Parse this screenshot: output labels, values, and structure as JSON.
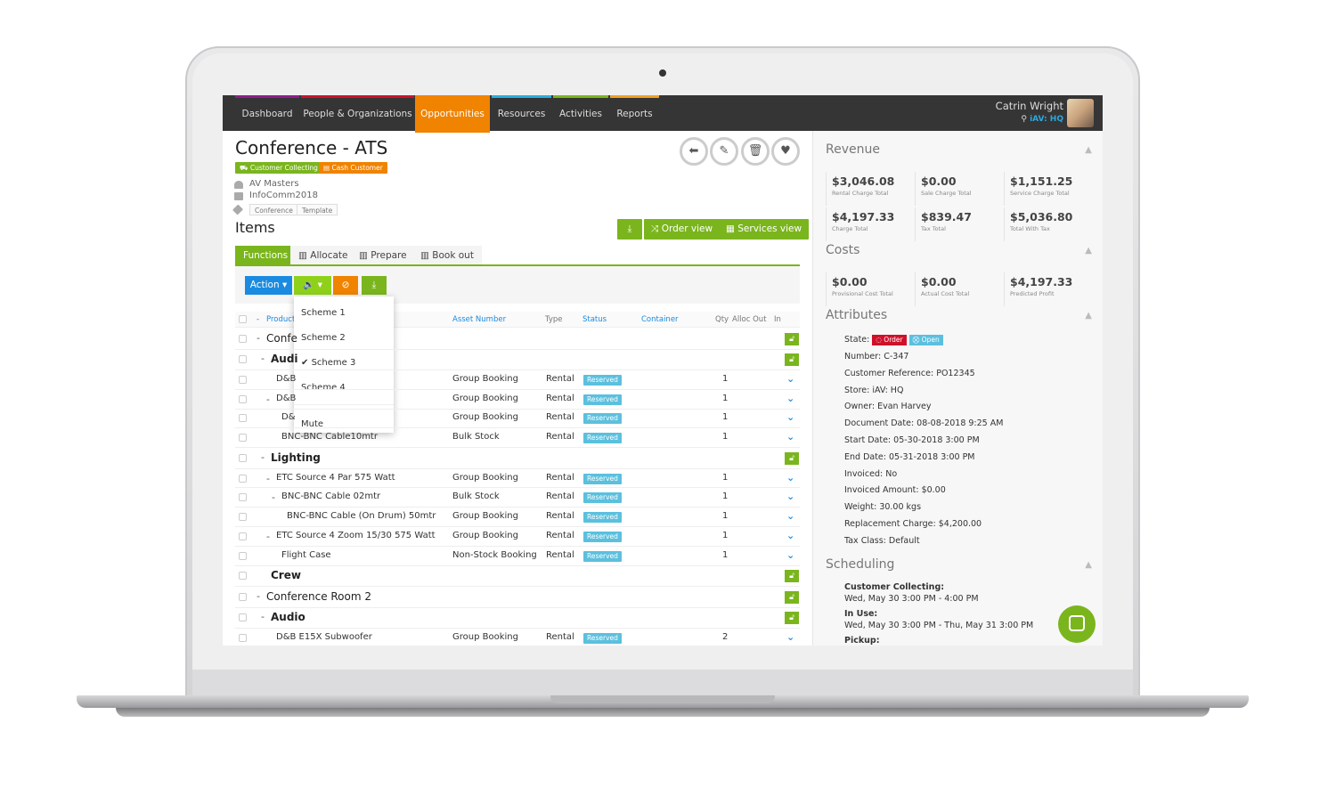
{
  "nav": {
    "items": [
      "Dashboard",
      "People & Organizations",
      "Opportunities",
      "Resources",
      "Activities",
      "Reports"
    ],
    "active": "Opportunities",
    "stripe_colors": [
      "#8e1f8e",
      "#d0102a",
      "#f08300",
      "#29aee0",
      "#7ab51d",
      "#f0a020"
    ]
  },
  "user": {
    "name": "Catrin Wright",
    "location": "iAV: HQ"
  },
  "header": {
    "title": "Conference - ATS",
    "tags": [
      "Customer Collecting",
      "Cash Customer"
    ],
    "organization": "AV Masters",
    "project": "InfoComm2018",
    "labels": [
      "Conference",
      "Template"
    ]
  },
  "actions": {
    "icons": [
      "back-arrow-icon",
      "pencil-icon",
      "trash-icon",
      "heart-icon"
    ]
  },
  "items": {
    "title": "Items",
    "order_view": "Order view",
    "services_view": "Services view",
    "tabs": [
      "Functions",
      "Allocate",
      "Prepare",
      "Book out"
    ],
    "action": "Action ▾"
  },
  "dropdown": {
    "options": [
      "Scheme 1",
      "Scheme 2",
      "Scheme 3",
      "Scheme 4"
    ],
    "selected": "Scheme 3",
    "mute": "Mute"
  },
  "table": {
    "headers": {
      "product": "Product",
      "asset": "Asset Number",
      "type": "Type",
      "status": "Status",
      "container": "Container",
      "qty": "Qty",
      "alloc": "Alloc Out",
      "in": "In"
    },
    "rows": [
      {
        "kind": "group",
        "level": 0,
        "name": "Confe"
      },
      {
        "kind": "group",
        "level": 1,
        "name": "Audi"
      },
      {
        "kind": "item",
        "level": 1,
        "dash": false,
        "name": "D&B",
        "asset": "Group Booking",
        "type": "Rental",
        "status": "Reserved",
        "qty": "1"
      },
      {
        "kind": "item",
        "level": 1,
        "dash": true,
        "name": "D&B",
        "asset": "Group Booking",
        "type": "Rental",
        "status": "Reserved",
        "qty": "1"
      },
      {
        "kind": "item",
        "level": 2,
        "dash": false,
        "name": "D&",
        "asset": "Group Booking",
        "type": "Rental",
        "status": "Reserved",
        "qty": "1"
      },
      {
        "kind": "item",
        "level": 2,
        "dash": false,
        "name": "BNC-BNC Cable10mtr",
        "asset": "Bulk Stock",
        "type": "Rental",
        "status": "Reserved",
        "qty": "1"
      },
      {
        "kind": "group",
        "level": 1,
        "name": "Lighting"
      },
      {
        "kind": "item",
        "level": 1,
        "dash": true,
        "name": "ETC Source 4 Par 575 Watt",
        "asset": "Group Booking",
        "type": "Rental",
        "status": "Reserved",
        "qty": "1"
      },
      {
        "kind": "item",
        "level": 2,
        "dash": true,
        "name": "BNC-BNC Cable 02mtr",
        "asset": "Bulk Stock",
        "type": "Rental",
        "status": "Reserved",
        "qty": "1"
      },
      {
        "kind": "item",
        "level": 3,
        "dash": false,
        "name": "BNC-BNC Cable (On Drum) 50mtr",
        "asset": "Group Booking",
        "type": "Rental",
        "status": "Reserved",
        "qty": "1"
      },
      {
        "kind": "item",
        "level": 1,
        "dash": true,
        "name": "ETC Source 4 Zoom 15/30 575 Watt",
        "asset": "Group Booking",
        "type": "Rental",
        "status": "Reserved",
        "qty": "1"
      },
      {
        "kind": "item",
        "level": 2,
        "dash": false,
        "name": "Flight Case",
        "asset": "Non-Stock Booking",
        "type": "Rental",
        "status": "Reserved",
        "qty": "1"
      },
      {
        "kind": "group",
        "level": 1,
        "nodash": true,
        "name": "Crew"
      },
      {
        "kind": "group",
        "level": 0,
        "name": "Conference Room 2"
      },
      {
        "kind": "group",
        "level": 1,
        "name": "Audio"
      },
      {
        "kind": "item",
        "level": 1,
        "dash": false,
        "name": "D&B E15X Subwoofer",
        "asset": "Group Booking",
        "type": "Rental",
        "status": "Reserved",
        "qty": "2"
      }
    ]
  },
  "revenue": {
    "title": "Revenue",
    "stats": [
      {
        "value": "$3,046.08",
        "label": "Rental Charge Total"
      },
      {
        "value": "$0.00",
        "label": "Sale Charge Total"
      },
      {
        "value": "$1,151.25",
        "label": "Service Charge Total"
      },
      {
        "value": "$4,197.33",
        "label": "Charge Total"
      },
      {
        "value": "$839.47",
        "label": "Tax Total"
      },
      {
        "value": "$5,036.80",
        "label": "Total With Tax"
      }
    ]
  },
  "costs": {
    "title": "Costs",
    "stats": [
      {
        "value": "$0.00",
        "label": "Provisional Cost Total"
      },
      {
        "value": "$0.00",
        "label": "Actual Cost Total"
      },
      {
        "value": "$4,197.33",
        "label": "Predicted Profit"
      }
    ]
  },
  "attributes": {
    "title": "Attributes",
    "state_label": "State:",
    "state_order": "Order",
    "state_open": "Open",
    "lines": [
      "Number: C-347",
      "Customer Reference: PO12345",
      "Store: iAV: HQ",
      "Owner: Evan Harvey",
      "Document Date: 08-08-2018 9:25 AM",
      "Start Date: 05-30-2018 3:00 PM",
      "End Date: 05-31-2018 3:00 PM",
      "Invoiced: No",
      "Invoiced Amount: $0.00",
      "Weight: 30.00 kgs",
      "Replacement Charge: $4,200.00",
      "Tax Class: Default"
    ]
  },
  "scheduling": {
    "title": "Scheduling",
    "entries": [
      {
        "label": "Customer Collecting:",
        "value": "Wed, May 30 3:00 PM - 4:00 PM"
      },
      {
        "label": "In Use:",
        "value": "Wed, May 30 3:00 PM - Thu, May 31 3:00 PM"
      },
      {
        "label": "Pickup:",
        "value": ""
      }
    ]
  },
  "colors": {
    "accent": "#f08300",
    "green": "#7ab51d",
    "blue": "#1a8be0",
    "reserved": "#5bc0de",
    "order": "#d0102a"
  }
}
